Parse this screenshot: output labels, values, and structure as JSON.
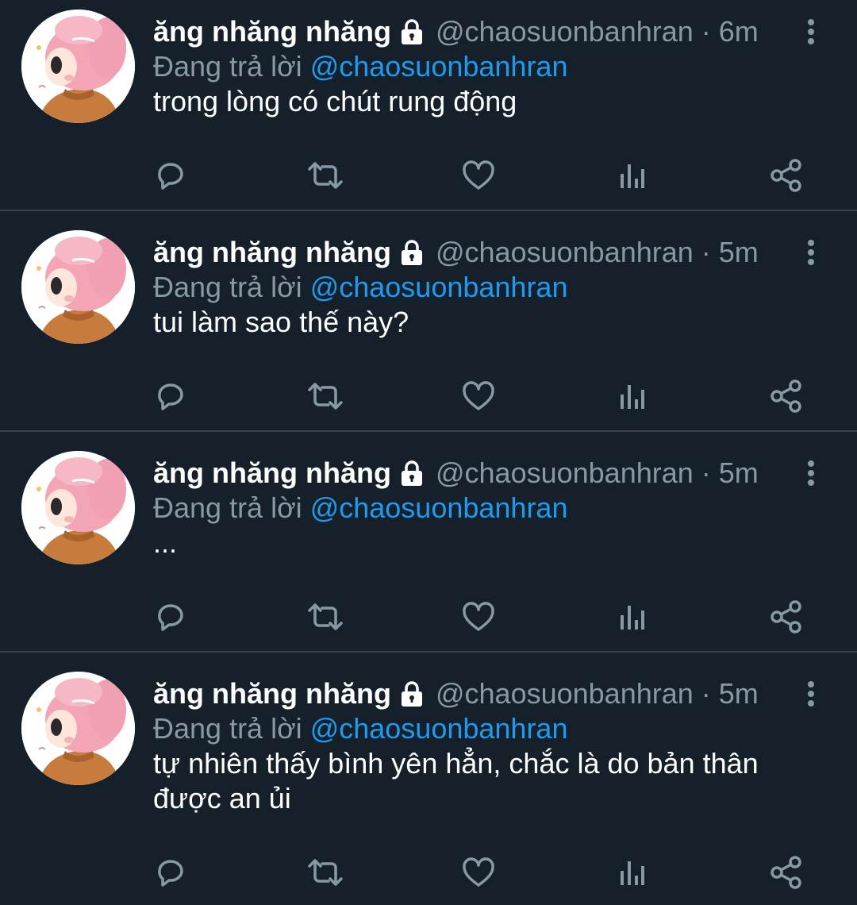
{
  "tweets": [
    {
      "name": "ăng nhăng nhăng",
      "handle": "@chaosuonbanhran",
      "time": "6m",
      "reply_prefix": "Đang trả lời",
      "reply_to": "@chaosuonbanhran",
      "text": "trong lòng có chút rung động"
    },
    {
      "name": "ăng nhăng nhăng",
      "handle": "@chaosuonbanhran",
      "time": "5m",
      "reply_prefix": "Đang trả lời",
      "reply_to": "@chaosuonbanhran",
      "text": "tui làm sao thế này?"
    },
    {
      "name": "ăng nhăng nhăng",
      "handle": "@chaosuonbanhran",
      "time": "5m",
      "reply_prefix": "Đang trả lời",
      "reply_to": "@chaosuonbanhran",
      "text": "..."
    },
    {
      "name": "ăng nhăng nhăng",
      "handle": "@chaosuonbanhran",
      "time": "5m",
      "reply_prefix": "Đang trả lời",
      "reply_to": "@chaosuonbanhran",
      "text": "tự nhiên thấy bình yên hẳn, chắc là do bản thân được an ủi"
    }
  ],
  "separator": "·",
  "icons": {
    "lock": "lock-icon",
    "more": "more-vertical-icon",
    "reply": "reply-icon",
    "retweet": "retweet-icon",
    "like": "heart-icon",
    "analytics": "analytics-icon",
    "share": "share-icon"
  },
  "colors": {
    "background": "#15202b",
    "secondary_text": "#8899a6",
    "link": "#1d9bf0",
    "divider": "#38444d"
  }
}
